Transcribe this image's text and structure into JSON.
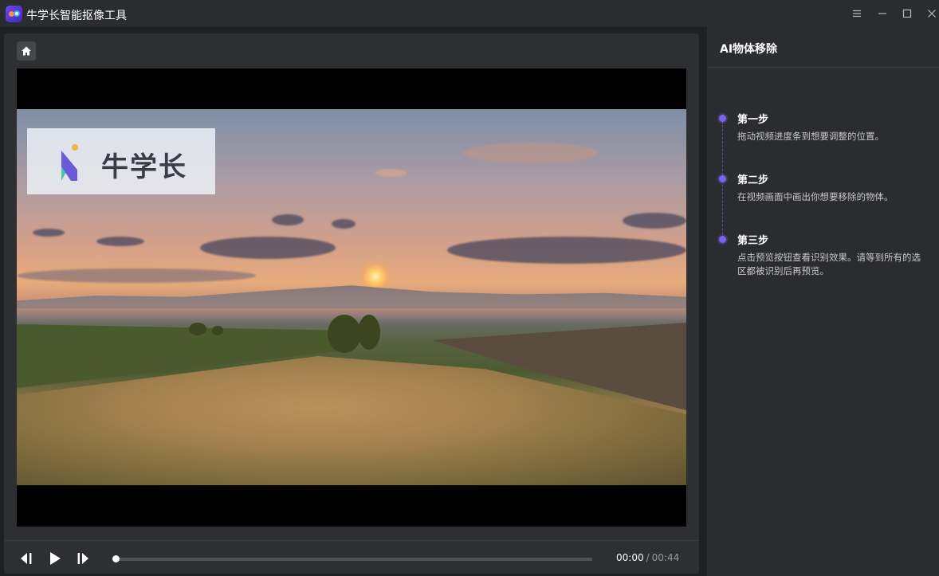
{
  "window": {
    "title": "牛学长智能抠像工具"
  },
  "video": {
    "watermark_text": "牛学长",
    "time_current": "00:00",
    "time_separator": "/",
    "time_total": "00:44",
    "progress": 0.0
  },
  "panel": {
    "title": "AI物体移除",
    "steps": [
      {
        "title": "第一步",
        "desc": "拖动视频进度条到想要调整的位置。"
      },
      {
        "title": "第二步",
        "desc": "在视频画面中画出你想要移除的物体。"
      },
      {
        "title": "第三步",
        "desc": "点击预览按钮查看识别效果。请等到所有的选区都被识别后再预览。"
      }
    ]
  },
  "colors": {
    "accent": "#7a63f0",
    "background": "#1f2023",
    "panel": "#2b2c30"
  }
}
